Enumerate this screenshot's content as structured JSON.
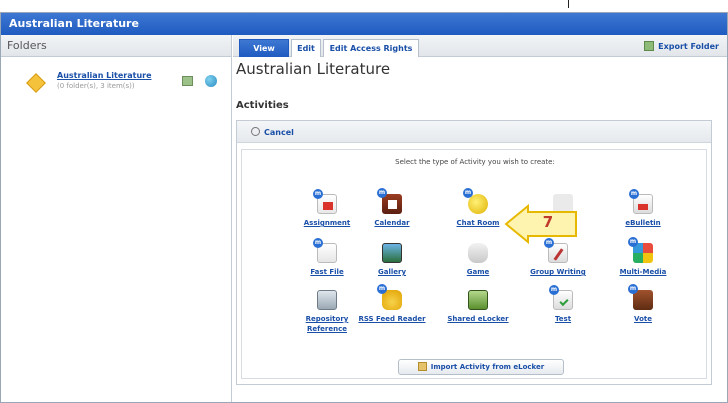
{
  "window": {
    "title": "Australian Literature"
  },
  "folders_header": "Folders",
  "folder": {
    "name": "Australian Literature",
    "meta": "(0 folder(s), 3 item(s))"
  },
  "tabs": [
    {
      "label": "View",
      "active": true
    },
    {
      "label": "Edit",
      "active": false
    },
    {
      "label": "Edit Access Rights",
      "active": false
    }
  ],
  "export_label": "Export Folder",
  "page_title": "Australian Literature",
  "section_title": "Activities",
  "cancel_label": "Cancel",
  "prompt": "Select the type of Activity you wish to create:",
  "activities": [
    {
      "label": "Assignment",
      "icon": "assignment-icon"
    },
    {
      "label": "Calendar",
      "icon": "calendar-icon"
    },
    {
      "label": "Chat Room",
      "icon": "chat-room-icon"
    },
    {
      "label": "",
      "icon": "hidden-by-callout"
    },
    {
      "label": "eBulletin",
      "icon": "ebulletin-icon"
    },
    {
      "label": "Fast File",
      "icon": "fast-file-icon"
    },
    {
      "label": "Gallery",
      "icon": "gallery-icon"
    },
    {
      "label": "Game",
      "icon": "game-icon"
    },
    {
      "label": "Group Writing",
      "icon": "group-writing-icon"
    },
    {
      "label": "Multi-Media",
      "icon": "multi-media-icon"
    },
    {
      "label": "Repository Reference",
      "icon": "repository-reference-icon"
    },
    {
      "label": "RSS Feed Reader",
      "icon": "rss-feed-reader-icon"
    },
    {
      "label": "Shared eLocker",
      "icon": "shared-elocker-icon"
    },
    {
      "label": "Test",
      "icon": "test-icon"
    },
    {
      "label": "Vote",
      "icon": "vote-icon"
    }
  ],
  "import_label": "Import Activity from eLocker",
  "callout_number": "7",
  "colors": {
    "titlebar": "#2a63c7",
    "link": "#1a4fa8",
    "callout_fill": "#fff3b0",
    "callout_border": "#e6b800",
    "callout_text": "#c0392b"
  }
}
